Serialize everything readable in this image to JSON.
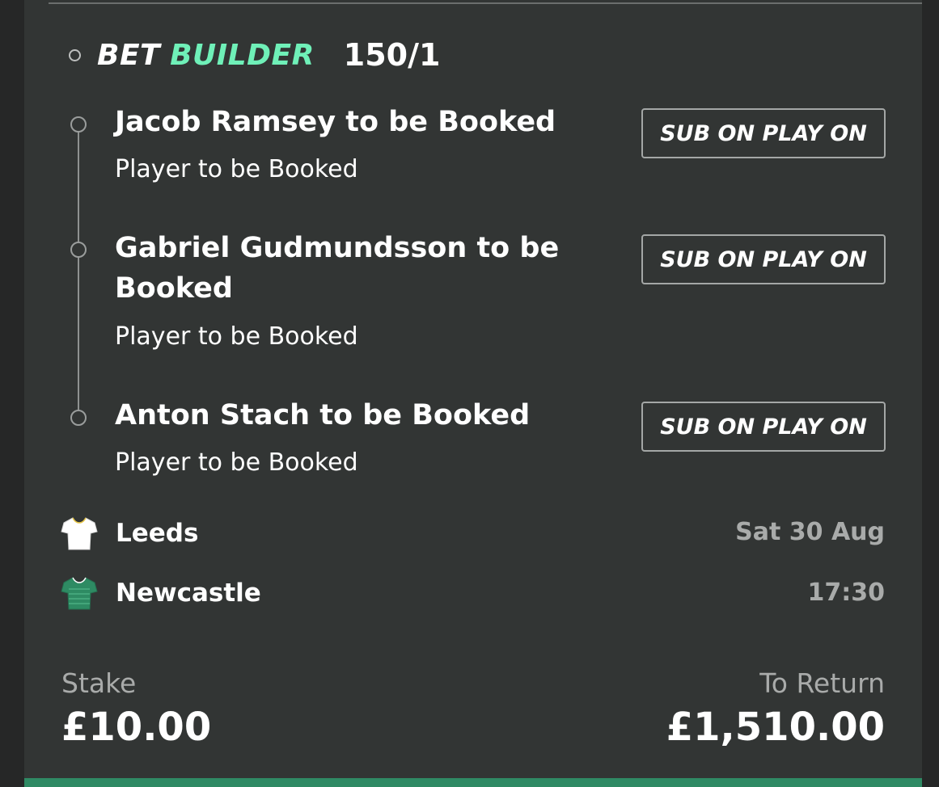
{
  "header": {
    "bet": "BET",
    "builder": "BUILDER",
    "odds": "150/1"
  },
  "legs": [
    {
      "title": "Jacob Ramsey to be Booked",
      "market": "Player to be Booked",
      "button": "SUB ON PLAY ON"
    },
    {
      "title": "Gabriel Gudmundsson to be Booked",
      "market": "Player to be Booked",
      "button": "SUB ON PLAY ON"
    },
    {
      "title": "Anton Stach to be Booked",
      "market": "Player to be Booked",
      "button": "SUB ON PLAY ON"
    }
  ],
  "match": {
    "home": {
      "name": "Leeds",
      "shirt_icon": "white-shirt-icon",
      "shirt_color": "#ffffff"
    },
    "away": {
      "name": "Newcastle",
      "shirt_icon": "green-shirt-icon",
      "shirt_color": "#2e8b63"
    },
    "date": "Sat 30 Aug",
    "time": "17:30"
  },
  "stake": {
    "label": "Stake",
    "value": "£10.00"
  },
  "to_return": {
    "label": "To Return",
    "value": "£1,510.00"
  },
  "colors": {
    "accent": "#6ff0b8",
    "card_bg": "#323534",
    "page_bg": "#262727",
    "bottom_bar": "#2f8a64"
  }
}
